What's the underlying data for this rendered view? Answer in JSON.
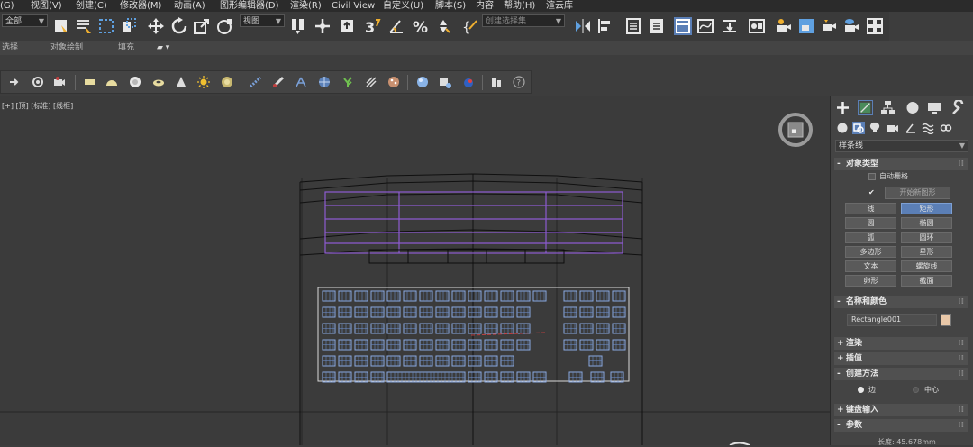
{
  "menu": {
    "items": [
      {
        "label": "(G)"
      },
      {
        "label": "视图(V)"
      },
      {
        "label": "创建(C)"
      },
      {
        "label": "修改器(M)"
      },
      {
        "label": "动画(A)"
      },
      {
        "label": "图形编辑器(D)"
      },
      {
        "label": "渲染(R)"
      },
      {
        "label": "Civil View"
      },
      {
        "label": "自定义(U)"
      },
      {
        "label": "脚本(S)"
      },
      {
        "label": "内容"
      },
      {
        "label": "帮助(H)"
      },
      {
        "label": "渲云库"
      }
    ]
  },
  "toolbar": {
    "filter_value": "全部",
    "coord_value": "视图",
    "selection_set_placeholder": "创建选择集"
  },
  "ribbon": {
    "items": [
      {
        "label": "选择"
      },
      {
        "label": "对象绘制"
      },
      {
        "label": "填充"
      }
    ]
  },
  "viewport": {
    "label": "[+] [顶] [标准] [线框]"
  },
  "panel": {
    "category": "样条线",
    "object_type": {
      "title": "对象类型",
      "autogrid": "自动栅格",
      "start_new_shape": "开始新图形",
      "buttons": [
        "线",
        "矩形",
        "圆",
        "椭圆",
        "弧",
        "圆环",
        "多边形",
        "星形",
        "文本",
        "螺旋线",
        "卵形",
        "截面"
      ],
      "active_button": "矩形"
    },
    "name_color": {
      "title": "名称和颜色",
      "name_value": "Rectangle001",
      "swatch_color": "#e9c8a8"
    },
    "rollouts": {
      "render": "渲染",
      "interpolation": "插值",
      "creation_method": "创建方法",
      "keyboard_input": "键盘输入",
      "parameters": "参数"
    },
    "creation_method": {
      "option_edge": "边",
      "option_center": "中心"
    },
    "params_hint": "长度: 45.678mm"
  },
  "colors": {
    "accent_blue": "#5b7fb6",
    "viewport_border": "#c8a03c",
    "selection_purple": "#8c5ad0"
  }
}
